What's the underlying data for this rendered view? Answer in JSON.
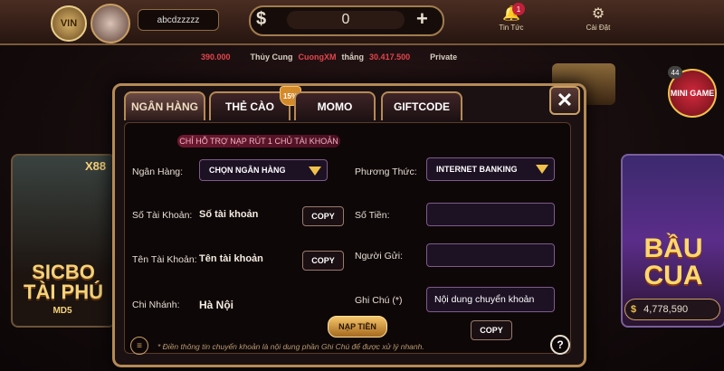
{
  "header": {
    "logo_text": "VIN",
    "username": "abcdzzzzz",
    "balance": "0",
    "news_label": "Tin Tức",
    "news_count": "1",
    "settings_label": "Cài Đặt"
  },
  "ticker": {
    "amount_left": "390.000",
    "prefix": "Thủy Cung",
    "player": "CuongXM",
    "verb": "thắng",
    "amount": "30.417.500",
    "suffix": "Private"
  },
  "games": {
    "left": {
      "multiplier": "X88",
      "title": "SICBO TÀI PHÚ",
      "subtitle": "MD5"
    },
    "right": {
      "title": "BẦU CUA",
      "jackpot": "4,778,590"
    },
    "mini_game": "MINI GAME",
    "mini_badge": "44"
  },
  "modal": {
    "tabs": [
      "NGÂN HÀNG",
      "THẺ CÀO",
      "MOMO",
      "GIFTCODE"
    ],
    "active_tab": 0,
    "promo_badge": "15%",
    "notice": "CHỈ HỖ TRỢ NẠP RÚT 1 CHỦ TÀI KHOẢN",
    "left": {
      "bank_label": "Ngân Hàng:",
      "bank_select": "CHỌN NGÂN HÀNG",
      "account_label": "Số Tài Khoản:",
      "account_value": "Số tài khoản",
      "name_label": "Tên Tài Khoản:",
      "name_value": "Tên tài khoản",
      "branch_label": "Chi Nhánh:",
      "branch_value": "Hà Nội",
      "copy": "COPY"
    },
    "right": {
      "method_label": "Phương Thức:",
      "method_select": "INTERNET BANKING",
      "amount_label": "Số Tiền:",
      "sender_label": "Người Gửi:",
      "note_label": "Ghi Chú (*)",
      "note_value": "Nội dung chuyển khoản",
      "copy": "COPY"
    },
    "submit": "NẠP TIỀN",
    "footnote": "* Điền thông tin chuyển khoản là nội dung phần Ghi Chú để được xử lý nhanh.",
    "help": "?"
  },
  "colors": {
    "accent": "#b58a55",
    "gold": "#f0c24b",
    "red": "#e2454c"
  }
}
